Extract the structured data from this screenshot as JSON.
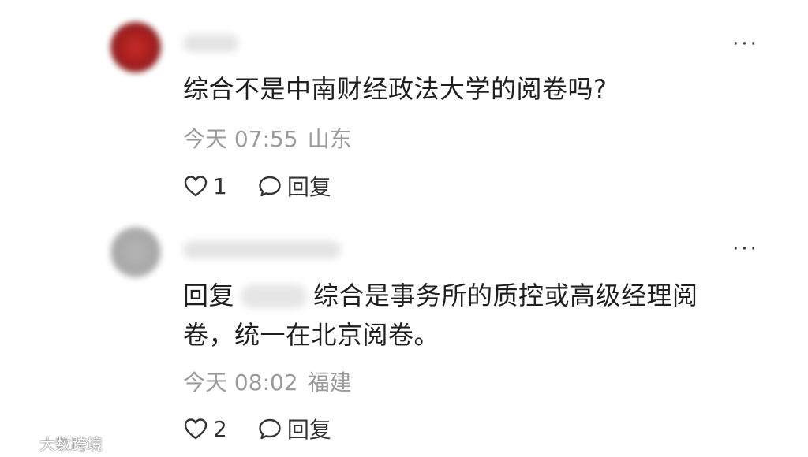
{
  "comments": [
    {
      "avatar": "avatar-red",
      "text": "综合不是中南财经政法大学的阅卷吗?",
      "time": "今天 07:55",
      "location": "山东",
      "likes": "1",
      "reply_label": "回复",
      "more": "···"
    },
    {
      "avatar": "avatar-gray",
      "reply_prefix": "回复",
      "text": "综合是事务所的质控或高级经理阅卷，统一在北京阅卷。",
      "time": "今天 08:02",
      "location": "福建",
      "likes": "2",
      "reply_label": "回复",
      "more": "···"
    }
  ],
  "icons": {
    "like": "heart-outline-icon",
    "reply": "speech-bubble-icon",
    "more": "more-horizontal-icon"
  },
  "watermark": {
    "text": "大数跨境"
  }
}
